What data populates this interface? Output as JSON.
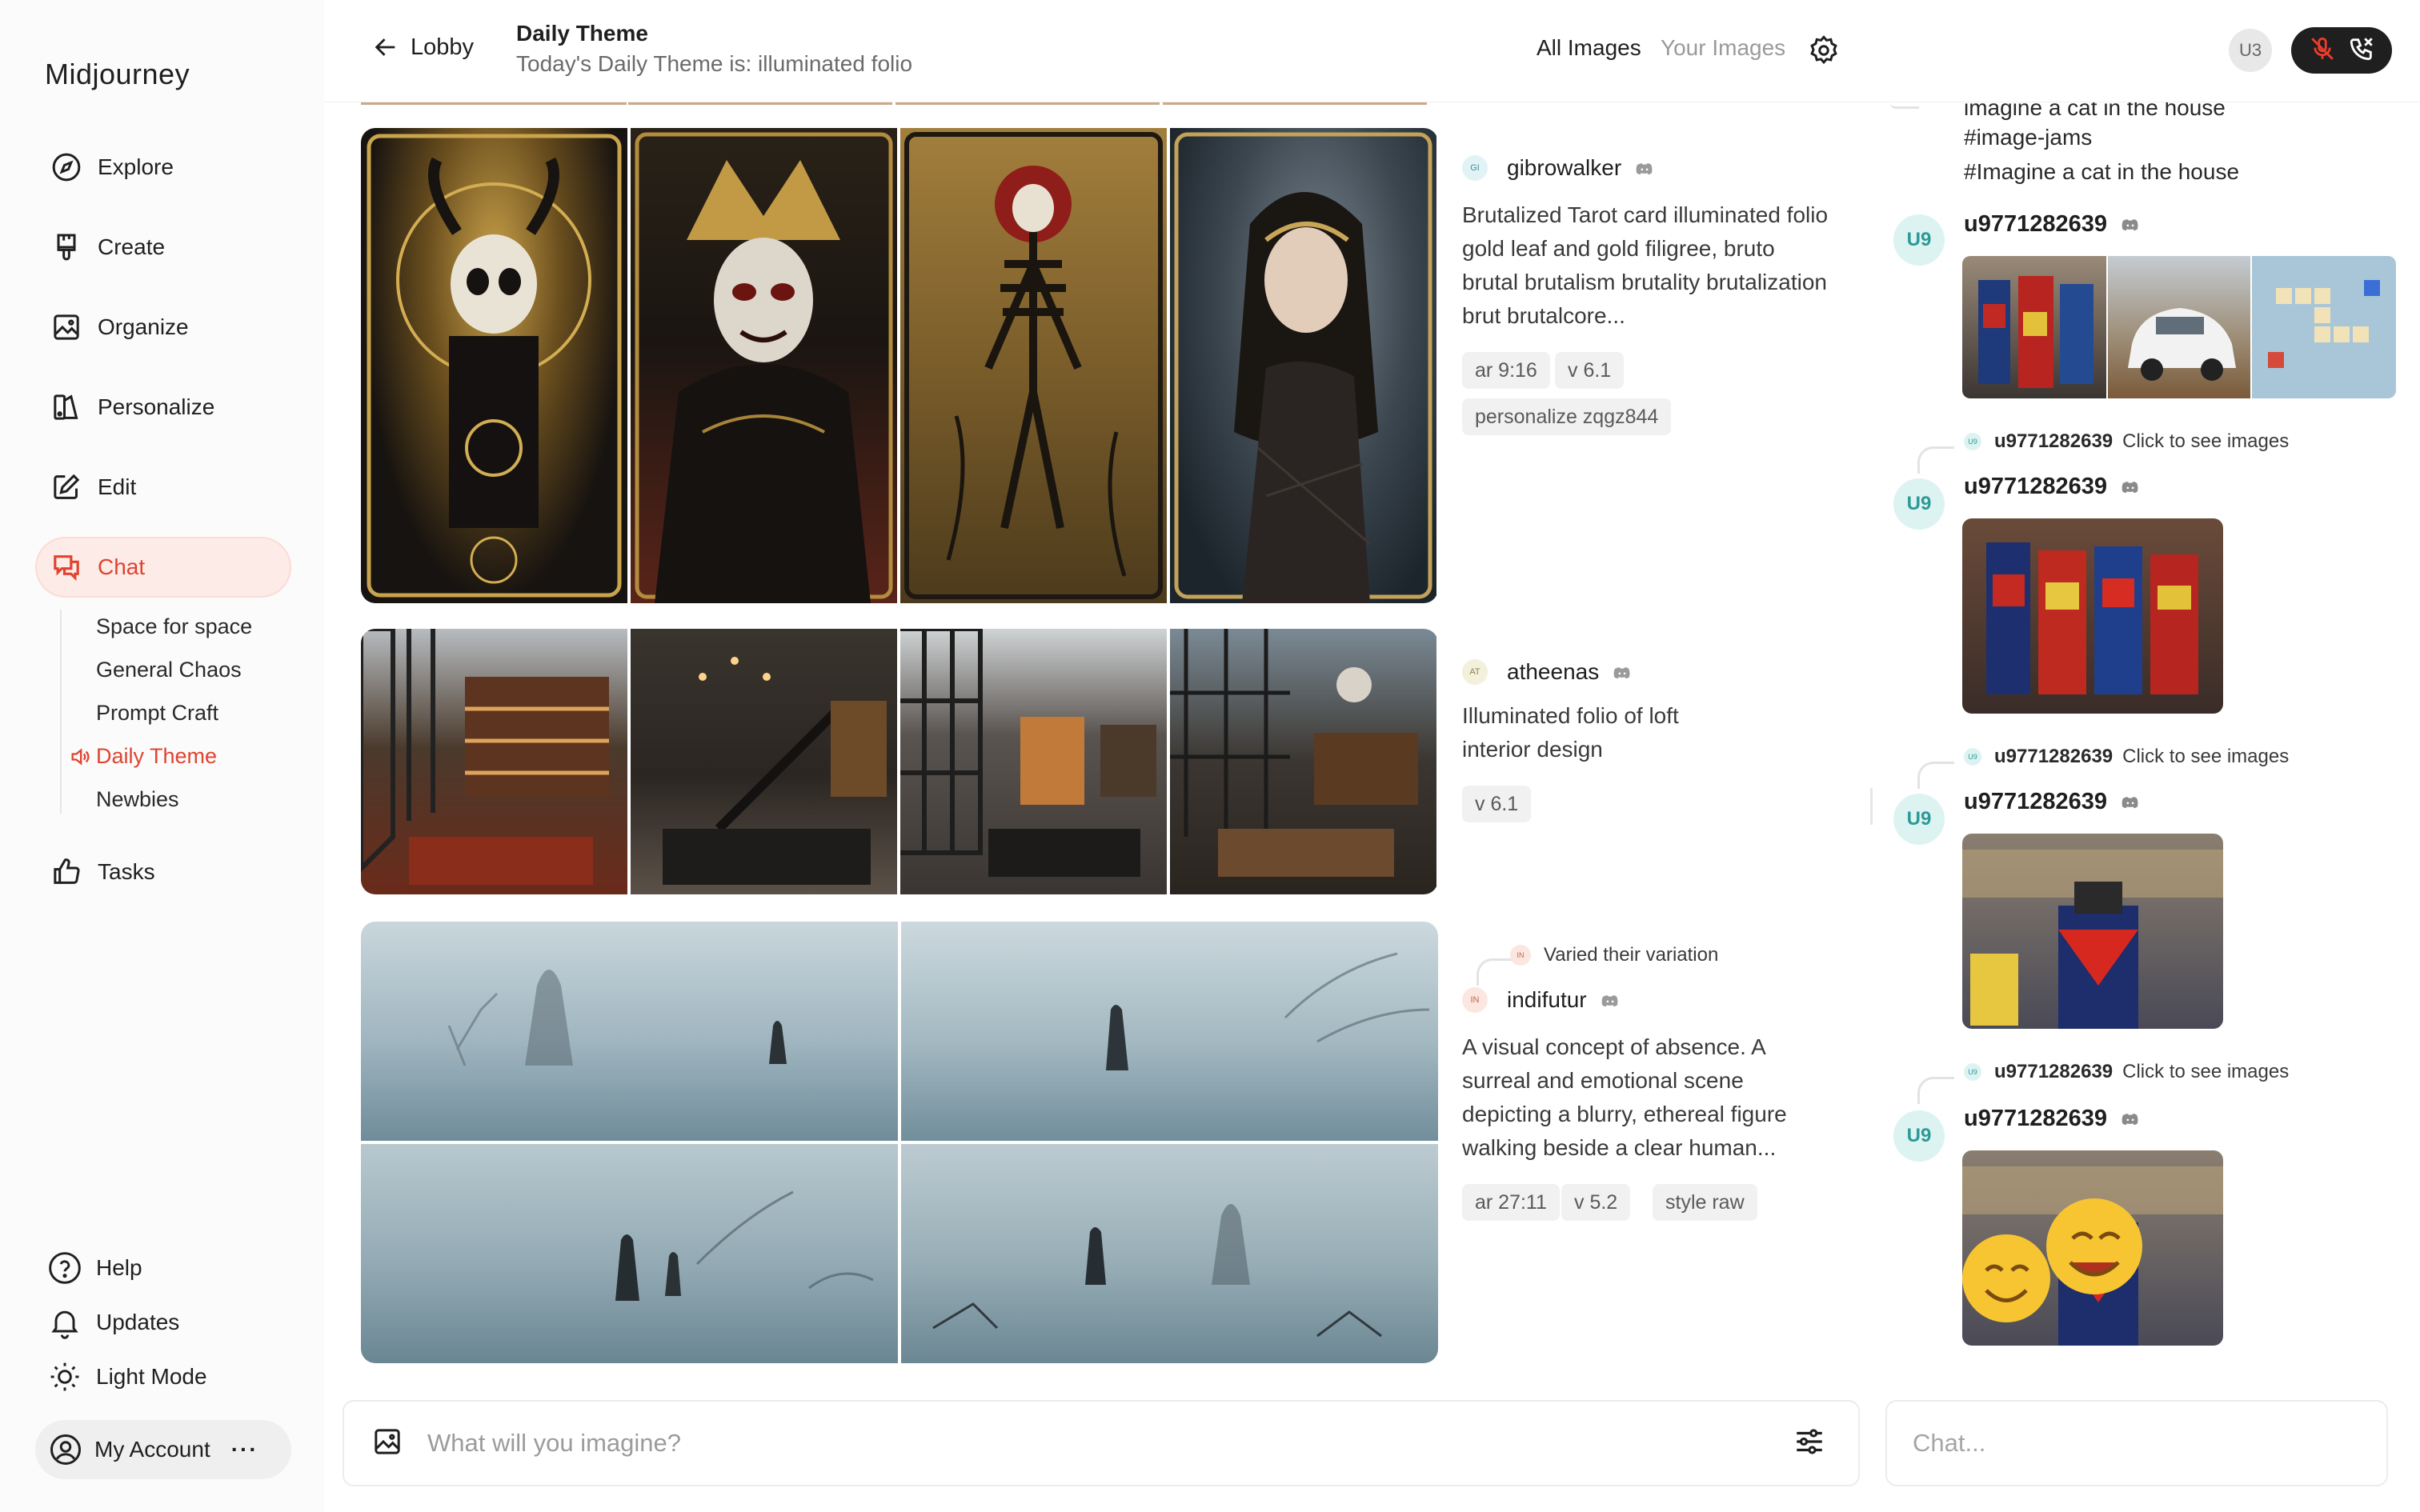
{
  "app": {
    "brand": "Midjourney"
  },
  "sidebar": {
    "nav": [
      {
        "label": "Explore",
        "icon": "compass-icon"
      },
      {
        "label": "Create",
        "icon": "brush-icon"
      },
      {
        "label": "Organize",
        "icon": "image-icon"
      },
      {
        "label": "Personalize",
        "icon": "personalize-icon"
      },
      {
        "label": "Edit",
        "icon": "edit-icon"
      },
      {
        "label": "Chat",
        "icon": "chat-icon",
        "active": true
      }
    ],
    "chat_rooms": [
      "Space for space",
      "General Chaos",
      "Prompt Craft",
      "Daily Theme",
      "Newbies"
    ],
    "active_room": "Daily Theme",
    "tasks": "Tasks",
    "footer": {
      "help": "Help",
      "updates": "Updates",
      "light_mode": "Light Mode",
      "account": "My Account",
      "more": "···"
    }
  },
  "header": {
    "back_label": "Lobby",
    "title": "Daily Theme",
    "subtitle": "Today's Daily Theme is: illuminated folio",
    "tab_all": "All Images",
    "tab_yours": "Your Images",
    "user_initials": "U3"
  },
  "feed": {
    "posts": [
      {
        "avatar": "GI",
        "avatar_color": "#e2f3f6",
        "username": "gibrowalker",
        "prompt": "Brutalized Tarot card illuminated folio gold leaf and gold filigree, bruto brutal brutalism brutality brutalization brut brutalcore...",
        "chips": [
          "ar 9:16",
          "v 6.1",
          "personalize zqgz844"
        ],
        "image_names": [
          "tarot-skull-card",
          "tarot-masked-face-card",
          "tarot-skeleton-card",
          "tarot-woman-card"
        ]
      },
      {
        "avatar": "AT",
        "avatar_color": "#f3f0dc",
        "username": "atheenas",
        "prompt": "Illuminated folio of loft interior design",
        "chips": [
          "v 6.1"
        ],
        "image_names": [
          "loft-library-room",
          "loft-staircase-bedroom",
          "loft-brick-living-room",
          "loft-windows-lounge"
        ]
      },
      {
        "avatar": "IN",
        "avatar_color": "#fbe7df",
        "username": "indifutur",
        "varied_label": "Varied their variation",
        "prompt": "A visual concept of absence. A surreal and emotional scene depicting a blurry, ethereal figure walking beside a clear human...",
        "chips": [
          "ar 27:11",
          "v 5.2",
          "style raw"
        ],
        "image_names": [
          "foggy-ghost-figures",
          "foggy-lone-figure",
          "foggy-two-figures",
          "foggy-figure-and-ghost"
        ]
      }
    ]
  },
  "chat": {
    "top_lines": [
      "imagine a cat in the house",
      "#image-jams",
      "#Imagine a cat in the house"
    ],
    "user_initials": "U9",
    "username": "u9771282639",
    "reply_text": "Click to see images",
    "message_images": [
      [
        "robot-toys-photo",
        "white-car-photo",
        "scrabble-board-photo"
      ],
      [
        "robot-figures-photo"
      ],
      [
        "toy-shop-robot-photo"
      ],
      [
        "emoji-robot-photo"
      ]
    ]
  },
  "composer": {
    "imagine_placeholder": "What will you imagine?",
    "chat_placeholder": "Chat..."
  },
  "colors": {
    "accent": "#e0432f",
    "accent_bg": "#fdebe8",
    "teal": "#2b9a97"
  }
}
